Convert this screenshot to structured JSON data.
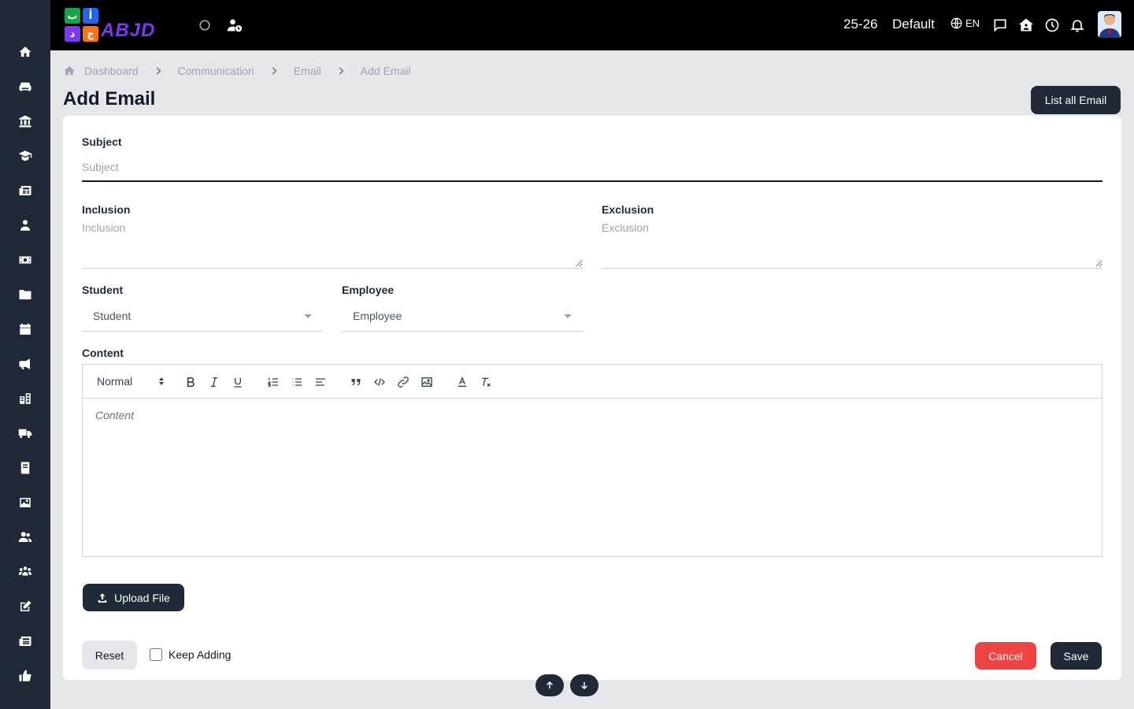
{
  "sidebar": {
    "items": [
      {
        "icon": "home-icon"
      },
      {
        "icon": "sofa-icon"
      },
      {
        "icon": "bank-icon"
      },
      {
        "icon": "graduate-icon"
      },
      {
        "icon": "newspaper-icon"
      },
      {
        "icon": "user-tie-icon"
      },
      {
        "icon": "money-icon"
      },
      {
        "icon": "folder-icon"
      },
      {
        "icon": "calendar-icon"
      },
      {
        "icon": "megaphone-icon"
      },
      {
        "icon": "school-icon"
      },
      {
        "icon": "truck-icon"
      },
      {
        "icon": "book-icon"
      },
      {
        "icon": "image-icon"
      },
      {
        "icon": "users-icon"
      },
      {
        "icon": "group-icon"
      },
      {
        "icon": "edit-icon"
      },
      {
        "icon": "news-icon"
      },
      {
        "icon": "thumbs-up-icon"
      }
    ]
  },
  "topbar": {
    "logo_text": "ABJD",
    "logo_tiles": [
      "ب",
      "أ",
      "د",
      "ج"
    ],
    "session": "25-26",
    "profile": "Default",
    "language": "EN"
  },
  "breadcrumb": {
    "items": [
      "Dashboard",
      "Communication",
      "Email",
      "Add Email"
    ]
  },
  "page": {
    "title": "Add Email",
    "list_button": "List all Email"
  },
  "form": {
    "subject_label": "Subject",
    "subject_placeholder": "Subject",
    "inclusion_label": "Inclusion",
    "inclusion_placeholder": "Inclusion",
    "exclusion_label": "Exclusion",
    "exclusion_placeholder": "Exclusion",
    "student_label": "Student",
    "student_value": "Student",
    "employee_label": "Employee",
    "employee_value": "Employee",
    "content_label": "Content",
    "content_placeholder": "Content",
    "format_value": "Normal",
    "upload_label": "Upload File",
    "reset_label": "Reset",
    "keep_adding_label": "Keep Adding",
    "cancel_label": "Cancel",
    "save_label": "Save"
  },
  "colors": {
    "sidebar_bg": "#1f2937",
    "topbar_bg": "#000000",
    "primary_button": "#1f2937",
    "cancel_button": "#ef4444",
    "page_bg": "#e5e7eb"
  }
}
